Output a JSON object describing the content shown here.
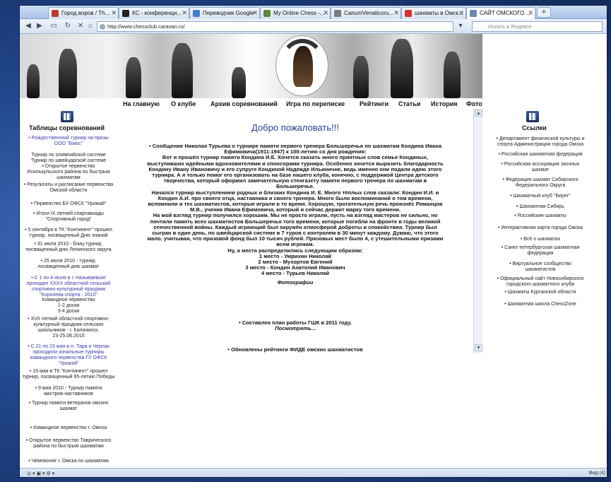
{
  "tabs": [
    {
      "label": "Город воров / Th...",
      "color": "#c0392b"
    },
    {
      "label": "КС - конференци...",
      "color": "#222222"
    },
    {
      "label": "Переводчик Google",
      "color": "#4a7bd0"
    },
    {
      "label": "My Online Chess -...",
      "color": "#5a8a3a"
    },
    {
      "label": "CanumVenaticoru...",
      "color": "#7a7a7a"
    },
    {
      "label": "шахматы в Омск...",
      "color": "#d2322d"
    },
    {
      "label": "САЙТ ОМСКОГО ...",
      "color": "#6a8ab0"
    }
  ],
  "address": "http://www.chessclub.caravan.ru/",
  "search_placeholder": "Искать в Яндексе",
  "menu": [
    "На главную",
    "О клубе",
    "Архив соревнований",
    "Игра по переписке",
    "Рейтинги",
    "Статьи",
    "История",
    "Фото"
  ],
  "left": {
    "title": "Таблицы соревнований",
    "items": [
      {
        "lines": [
          "• Рождественский турнир на призы",
          "ООО \"Баюс\""
        ],
        "blue": true
      },
      {
        "lines": [
          "Турнир по олимпийской системе",
          "Турнир по швейцарской системе"
        ]
      },
      {
        "lines": [
          "• Открытое первенство",
          "Исилькульского района по быстрым",
          "шахматам"
        ]
      },
      {
        "lines": [
          "• Результаты и расписание первенства",
          "Омской области"
        ]
      },
      {
        "lines": [
          "• Первенство БУ ОФСК \"Урожай\""
        ]
      },
      {
        "lines": [
          "• Итоги IX летней спартакиады",
          "\"Спортивный город\""
        ]
      },
      {
        "lines": [
          "• 5 сентября в ТК \"Континент\" прошел",
          "турнир, посвященный Дню знаний"
        ]
      },
      {
        "lines": [
          "• 31 июля 2010 - блиц-турнир,",
          "посвященный дню Ленинского округа"
        ]
      },
      {
        "lines": [
          "• 25 июля 2010 - турнир,",
          "посвященный дню шахмат"
        ]
      },
      {
        "lines": [
          "• С 1 по 4 июля в г. Называевске",
          "проходил XXXX областной сельский",
          "спортивно-культурный праздник",
          "\"Королева спорта - 2010\""
        ],
        "blue": true
      },
      {
        "lines": [
          "Командное первенство",
          "1-2 доски",
          "3-4 доски"
        ]
      },
      {
        "lines": [
          "• XVII летний областной спортивно-",
          "культурный праздник сельских",
          "школьников - г. Калачинск,",
          "23-25.06.2010"
        ]
      },
      {
        "lines": [
          "• С 21 по 23 мая в гг. Тара и Черлак",
          "проходили зональные турниры",
          "командного первенства ГУ ОФСК",
          "\"Урожай\""
        ],
        "blue": true
      },
      {
        "lines": [
          "• 15 мая в ТК \"Континент\" прошел",
          "турнир, посвященный 65-летию Победы"
        ]
      },
      {
        "lines": [
          "• 9 мая 2010 - Турнир памяти",
          "мастров-наставников"
        ]
      },
      {
        "lines": [
          "• Турнир памяти ветеранов омских",
          "шахмат"
        ]
      },
      {
        "lines": [
          "• Командное первенство г. Омска"
        ]
      },
      {
        "lines": [
          "• Открытое первенство Таврического",
          "района по быстрым шахматам"
        ]
      },
      {
        "lines": [
          "• Чемпионат г. Омска по шахматам"
        ]
      }
    ]
  },
  "right": {
    "title": "Ссылки",
    "items": [
      {
        "lines": [
          "• Департамент физической культуры и",
          "спорта Администрации города Омска"
        ]
      },
      {
        "lines": [
          "• Российская шахматная федерация"
        ]
      },
      {
        "lines": [
          "• Российская ассоциация заочных",
          "шахмат"
        ]
      },
      {
        "lines": [
          "• Федерация шахмат Сибирского",
          "Федерального Округа"
        ]
      },
      {
        "lines": [
          "• Шахматный клуб \"Берег\""
        ]
      },
      {
        "lines": [
          "• Шахматная Сибирь"
        ]
      },
      {
        "lines": [
          "• Российские шахматы"
        ]
      },
      {
        "lines": [
          "• Интерактивная карта города Омска"
        ]
      },
      {
        "lines": [
          "• Всё о шахматах"
        ]
      },
      {
        "lines": [
          "• Санкт-петербургская шахматная",
          "федерация"
        ]
      },
      {
        "lines": [
          "• Виртуальное сообщество",
          "шахматистов"
        ]
      },
      {
        "lines": [
          "• Официальный сайт Новосибирского",
          "городского шахматного клуба"
        ]
      },
      {
        "lines": [
          "• Шахматы Курганской области"
        ]
      },
      {
        "lines": [
          "• Шахматная школа ChessZone"
        ]
      }
    ]
  },
  "main": {
    "welcome": "Добро пожаловать!!!",
    "article_lines": [
      "• Сообщение Николая Турьева о турнире памяти первого тренера Большеречья по шахматам Кондина Ивана",
      "Ефимовича(1911-1947) к 100-летию со дня рождения:",
      "Вот и прошёл турнир памяти Кондина И.Е. Хочется сказать много приятных слов семье Кондиных,",
      "выступивших идейными вдохновителями и спонсорами турнира. Особенно хочется выразить благодарность",
      "Кондину Ивану Ивановичу и его супруге Кондиной Надежде Ильиничне, ведь именно они подали идею этого",
      "турнира. А я только помог его организовать на базе нашего клуба, конечно, с поддержкой Центра детского",
      "творчества, который оформил замечательную стенгазету памяти первого тренера по шахматам в",
      "Большеречье.",
      "Начался турнир выступлением родных и близких Кондина И. Е. Много тёплых слов сказали: Кондин И.И. и",
      "Кондин А.И. про своего отца, наставника и своего тренера. Много было воспоминаний о том времени,",
      "вспомнили и тех шахматистов, которые играли в то время. Хорошую, трогательную речь произнёс Романцов",
      "М.В., ученик Ивана Ефимовича, который и сейчас держит марку того времени.",
      "На мой взгляд турнир получился хорошим. Мы не просто играли, пусть на взгляд мастеров не сильно, но",
      "почтили память всех шахматистов Большеречья того времени, которые погибли на фронте в годы великой",
      "отечественной войны. Каждый играющий был окружён атмосферой доброты и спокойствия. Турнир был",
      "сыгран в один день, по швейцарской системе в 7 туров с контролем в 30 минут каждому. Думаю, что этого",
      "мало, учитывая, что призовой фонд был 10 тысяч рублей. Призовых мест было 4, с утешительными призами",
      "всем игрокам.",
      "Ну, а места распределились следующим образом:",
      "1 место - Умрихин Николай",
      "2 место - Мухортов Евгений",
      "3 место - Кондин Анатолий Иванович",
      "4 место - Турьев Николай"
    ],
    "photos_link": "Фотографии",
    "news2": "• Составлен план работы ГШК в 2011 году.",
    "see_link": "Посмотреть...",
    "news3": "• Обновлены рейтинги ФИДЕ омских шахматистов"
  },
  "status": {
    "right": "Вид (4)"
  }
}
